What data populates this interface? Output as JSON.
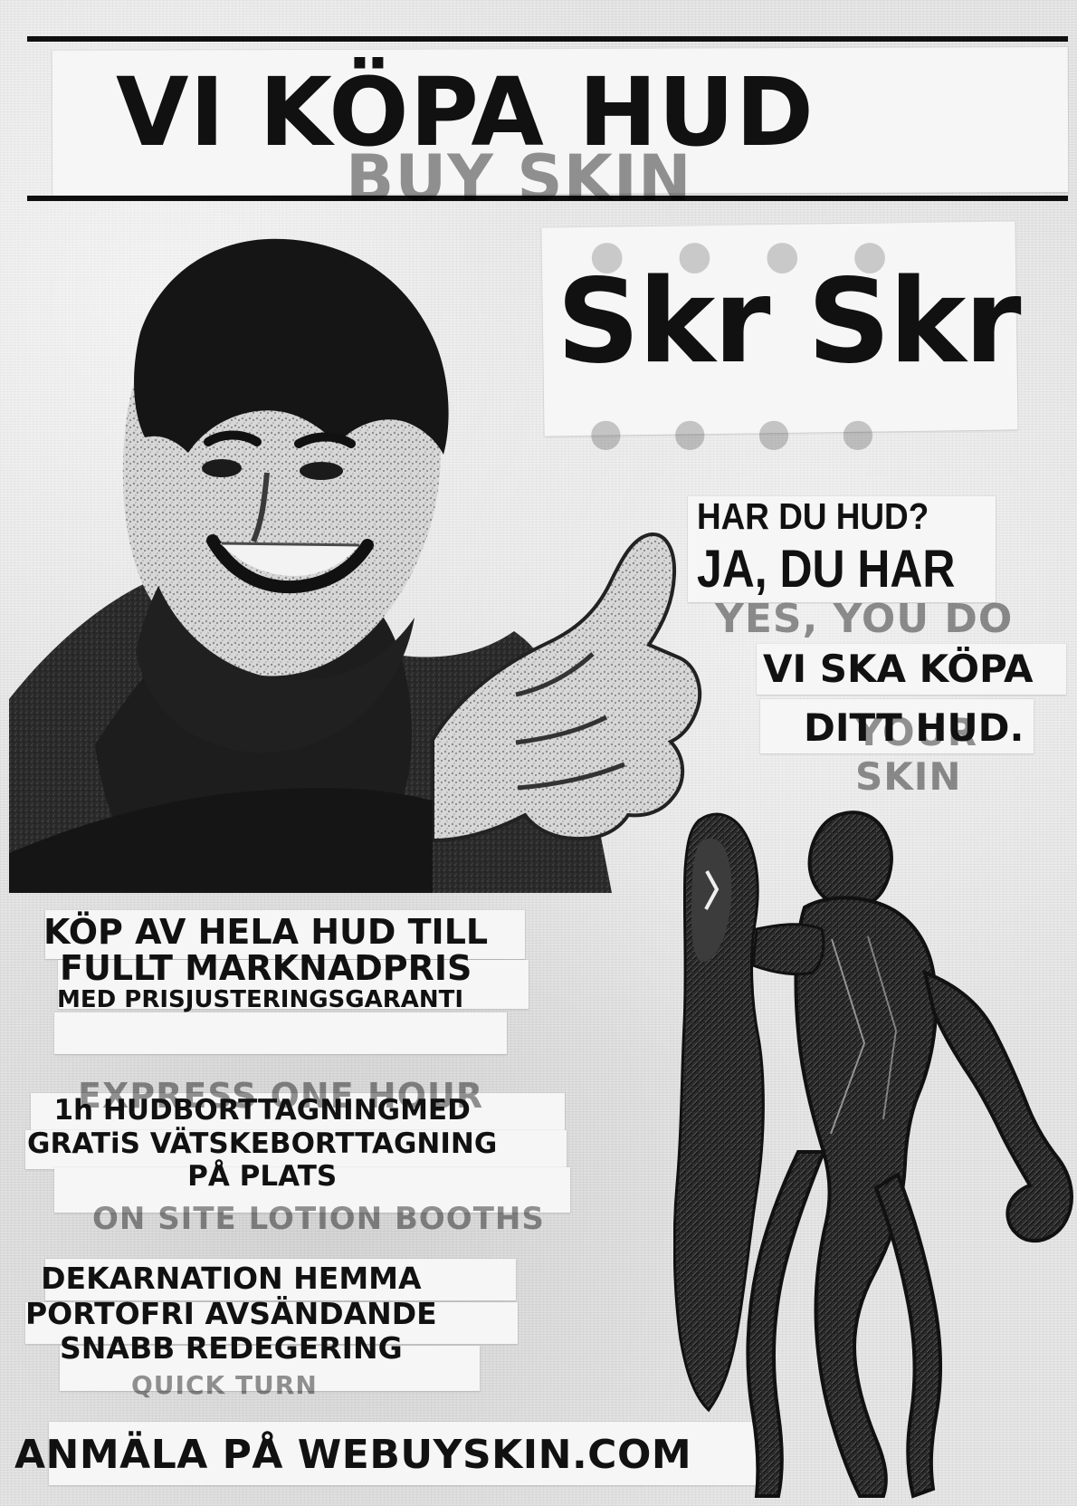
{
  "poster": {
    "title": "VI KÖPA HUD",
    "headline": "Skr Skr",
    "question": "HAR DU HUD?",
    "answer": "JA, DU HAR",
    "buy_line_1": "VI SKA KÖPA",
    "buy_line_2": "DITT HUD.",
    "offer_line_1": "KÖP AV HELA HUD TILL",
    "offer_line_2": "FULLT MARKNADPRIS",
    "offer_line_3": "MED PRISJUSTERINGSGARANTI",
    "service_line_1": "1h HUDBORTTAGNINGMED",
    "service_line_2": "GRATiS VÄTSKEBORTTAGNING",
    "service_line_3": "PÅ PLATS",
    "perk_line_1": "DEKARNATION HEMMA",
    "perk_line_2": "PORTOFRI AVSÄNDANDE",
    "perk_line_3": "SNABB REDEGERING",
    "signup": "ANMÄLA PÅ WEBUYSKIN.COM",
    "ghost_text_1": "YES, YOU DO",
    "ghost_text_2": "YOUR SKIN",
    "ghost_text_3": "EXPRESS ONE HOUR",
    "ghost_text_4": "ON SITE LOTION BOOTHS",
    "ghost_text_5": "QUICK TURN"
  },
  "colors": {
    "ink": "#111111",
    "paper": "#f6f6f6",
    "background": "#e7e7e7"
  }
}
